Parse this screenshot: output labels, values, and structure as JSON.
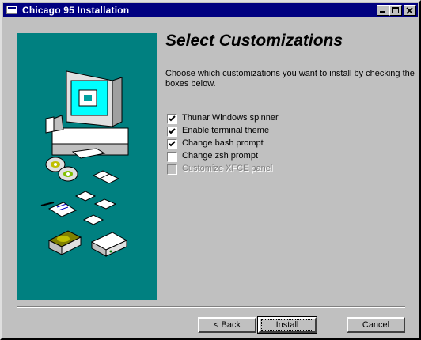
{
  "window": {
    "title": "Chicago 95 Installation",
    "controls": [
      "minimize-icon",
      "maximize-icon",
      "close-icon"
    ]
  },
  "main": {
    "heading": "Select Customizations",
    "description": "Choose which customizations you want to install by checking the boxes below."
  },
  "options": [
    {
      "label": "Thunar Windows spinner",
      "checked": true,
      "enabled": true
    },
    {
      "label": "Enable terminal theme",
      "checked": true,
      "enabled": true
    },
    {
      "label": "Change bash prompt",
      "checked": true,
      "enabled": true
    },
    {
      "label": "Change zsh prompt",
      "checked": false,
      "enabled": true
    },
    {
      "label": "Customize XFCE panel",
      "checked": false,
      "enabled": false
    }
  ],
  "buttons": {
    "back": "< Back",
    "install": "Install",
    "cancel": "Cancel"
  },
  "colors": {
    "titlebar": "#000080",
    "panel": "#008080",
    "face": "#c0c0c0"
  },
  "illustration": {
    "icons": [
      "computer-icon",
      "cd-icon",
      "floppy-disk-icon",
      "document-icon",
      "hard-drive-icon",
      "network-device-icon"
    ]
  }
}
